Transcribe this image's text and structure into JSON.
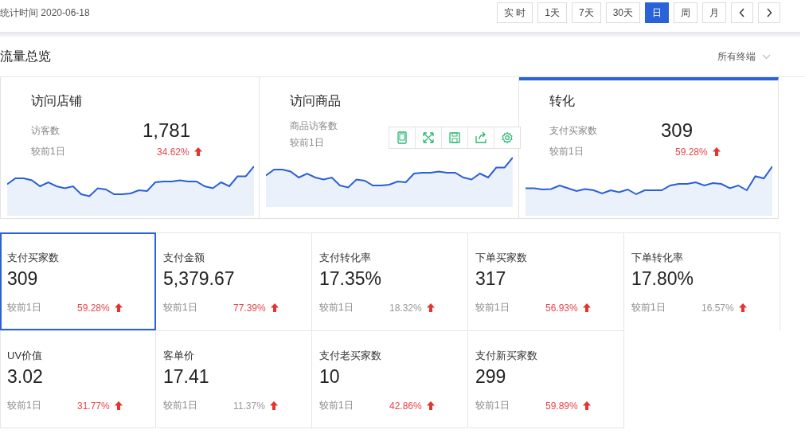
{
  "header": {
    "stat_date": "统计时间 2020-06-18",
    "ranges": [
      {
        "label": "实 时",
        "selected": false
      },
      {
        "label": "1天",
        "selected": false
      },
      {
        "label": "7天",
        "selected": false
      },
      {
        "label": "30天",
        "selected": false
      },
      {
        "label": "日",
        "selected": true
      },
      {
        "label": "周",
        "selected": false
      },
      {
        "label": "月",
        "selected": false
      }
    ],
    "nav": [
      {
        "kind": "prev"
      },
      {
        "kind": "next"
      }
    ]
  },
  "section": {
    "title": "流量总览",
    "terminal_filter": "所有终端"
  },
  "overview_cards": [
    {
      "title": "访问店铺",
      "metric_label": "访客数",
      "value": "1,781",
      "compare_label": "较前1日",
      "change": "34.62%",
      "selected": false
    },
    {
      "title": "访问商品",
      "metric_label": "商品访客数",
      "compare_label": "较前1日",
      "selected": false
    },
    {
      "title": "转化",
      "metric_label": "支付买家数",
      "value": "309",
      "compare_label": "较前1日",
      "change": "59.28%",
      "selected": true
    }
  ],
  "metrics": [
    {
      "label": "支付买家数",
      "value": "309",
      "compare_label": "较前1日",
      "change": "59.28%",
      "highlight": true,
      "selected": true
    },
    {
      "label": "支付金额",
      "value": "5,379.67",
      "compare_label": "较前1日",
      "change": "77.39%",
      "highlight": true,
      "selected": false
    },
    {
      "label": "支付转化率",
      "value": "17.35%",
      "compare_label": "较前1日",
      "change": "18.32%",
      "highlight": false,
      "selected": false
    },
    {
      "label": "下单买家数",
      "value": "317",
      "compare_label": "较前1日",
      "change": "56.93%",
      "highlight": true,
      "selected": false
    },
    {
      "label": "下单转化率",
      "value": "17.80%",
      "compare_label": "较前1日",
      "change": "16.57%",
      "highlight": false,
      "selected": false
    },
    {
      "label": "UV价值",
      "value": "3.02",
      "compare_label": "较前1日",
      "change": "31.77%",
      "highlight": true,
      "selected": false
    },
    {
      "label": "客单价",
      "value": "17.41",
      "compare_label": "较前1日",
      "change": "11.37%",
      "highlight": false,
      "selected": false
    },
    {
      "label": "支付老买家数",
      "value": "10",
      "compare_label": "较前1日",
      "change": "42.86%",
      "highlight": true,
      "selected": false
    },
    {
      "label": "支付新买家数",
      "value": "299",
      "compare_label": "较前1日",
      "change": "59.89%",
      "highlight": true,
      "selected": false
    }
  ]
}
